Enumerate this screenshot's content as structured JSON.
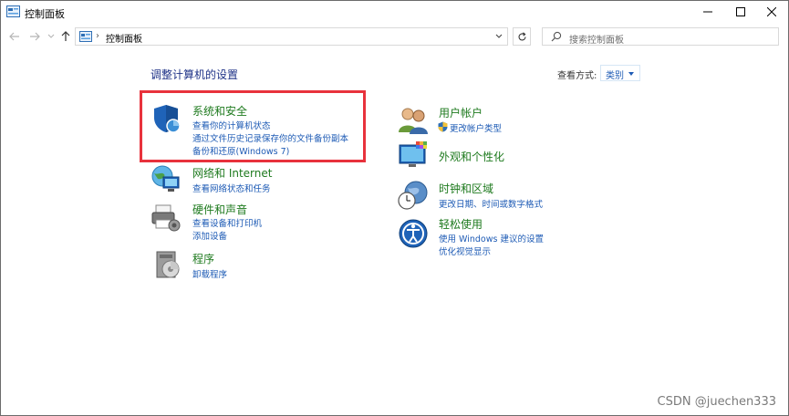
{
  "window": {
    "title": "控制面板",
    "controls": {
      "minimize": "minimize-icon",
      "maximize": "maximize-icon",
      "close": "close-icon"
    }
  },
  "navbar": {
    "breadcrumb_separator": "›",
    "address": "控制面板",
    "search_placeholder": "搜索控制面板"
  },
  "content": {
    "heading": "调整计算机的设置",
    "view_by_label": "查看方式:",
    "view_by_value": "类别"
  },
  "categories_left": [
    {
      "title": "系统和安全",
      "links": [
        "查看你的计算机状态",
        "通过文件历史记录保存你的文件备份副本",
        "备份和还原(Windows 7)"
      ]
    },
    {
      "title": "网络和 Internet",
      "links": [
        "查看网络状态和任务"
      ]
    },
    {
      "title": "硬件和声音",
      "links": [
        "查看设备和打印机",
        "添加设备"
      ]
    },
    {
      "title": "程序",
      "links": [
        "卸载程序"
      ]
    }
  ],
  "categories_right": [
    {
      "title": "用户帐户",
      "links": [
        "更改帐户类型"
      ]
    },
    {
      "title": "外观和个性化",
      "links": []
    },
    {
      "title": "时钟和区域",
      "links": [
        "更改日期、时间或数字格式"
      ]
    },
    {
      "title": "轻松使用",
      "links": [
        "使用 Windows 建议的设置",
        "优化视觉显示"
      ]
    }
  ],
  "colors": {
    "heading": "#1e3287",
    "category_title": "#1e7a1e",
    "link": "#1e5bb5",
    "highlight": "#e8323c"
  },
  "watermark": "CSDN @juechen333"
}
